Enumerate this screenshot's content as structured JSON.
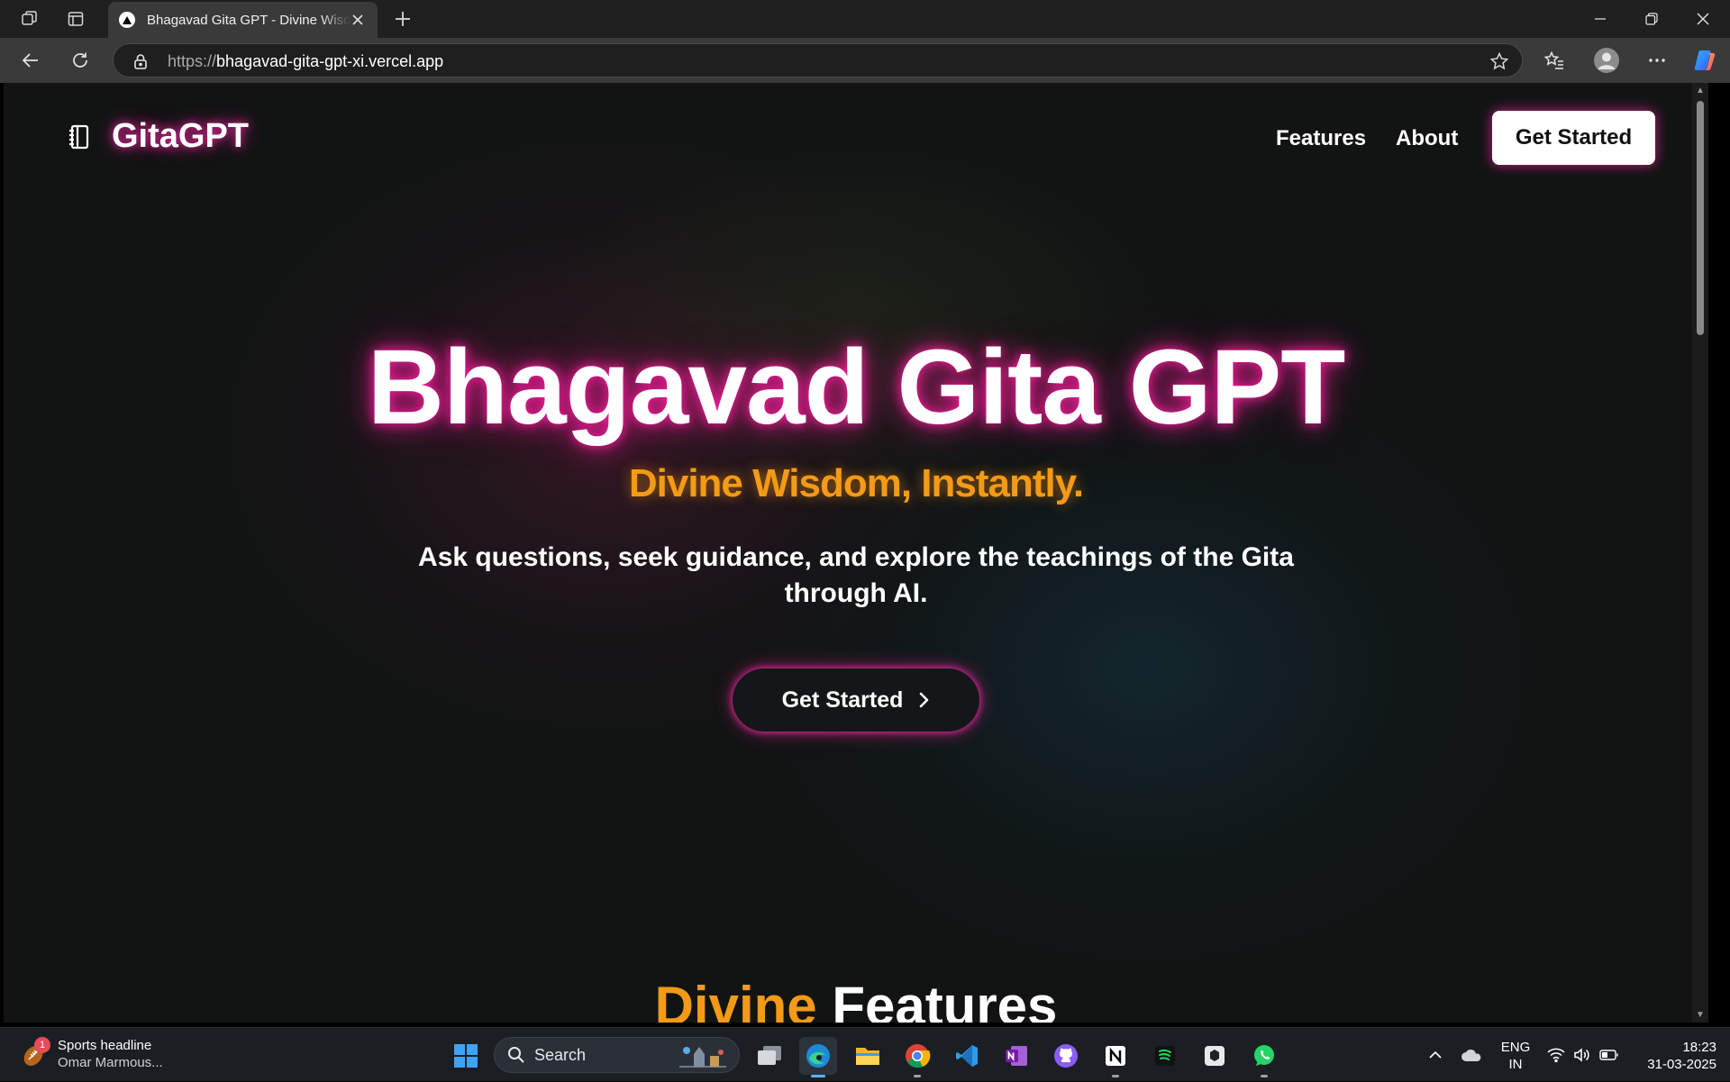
{
  "browser": {
    "tab_title": "Bhagavad Gita GPT - Divine Wisdom, Instantly.",
    "url_scheme": "https://",
    "url_host": "bhagavad-gita-gpt-xi.vercel.app"
  },
  "site": {
    "brand": "GitaGPT",
    "nav": {
      "features": "Features",
      "about": "About",
      "cta": "Get Started"
    },
    "hero": {
      "title": "Bhagavad Gita GPT",
      "subtitle": "Divine Wisdom, Instantly.",
      "description": "Ask questions, seek guidance, and explore the teachings of the Gita through AI.",
      "cta": "Get Started"
    },
    "section": {
      "accent": "Divine",
      "title": "Features"
    },
    "colors": {
      "accent_orange": "#f39a16",
      "glow_pink": "#ff28aa",
      "background": "#121414"
    }
  },
  "taskbar": {
    "news_headline": "Sports headline",
    "news_sub": "Omar Marmous...",
    "news_badge": "1",
    "search_label": "Search",
    "lang_line1": "ENG",
    "lang_line2": "IN",
    "time": "18:23",
    "date": "31-03-2025"
  }
}
